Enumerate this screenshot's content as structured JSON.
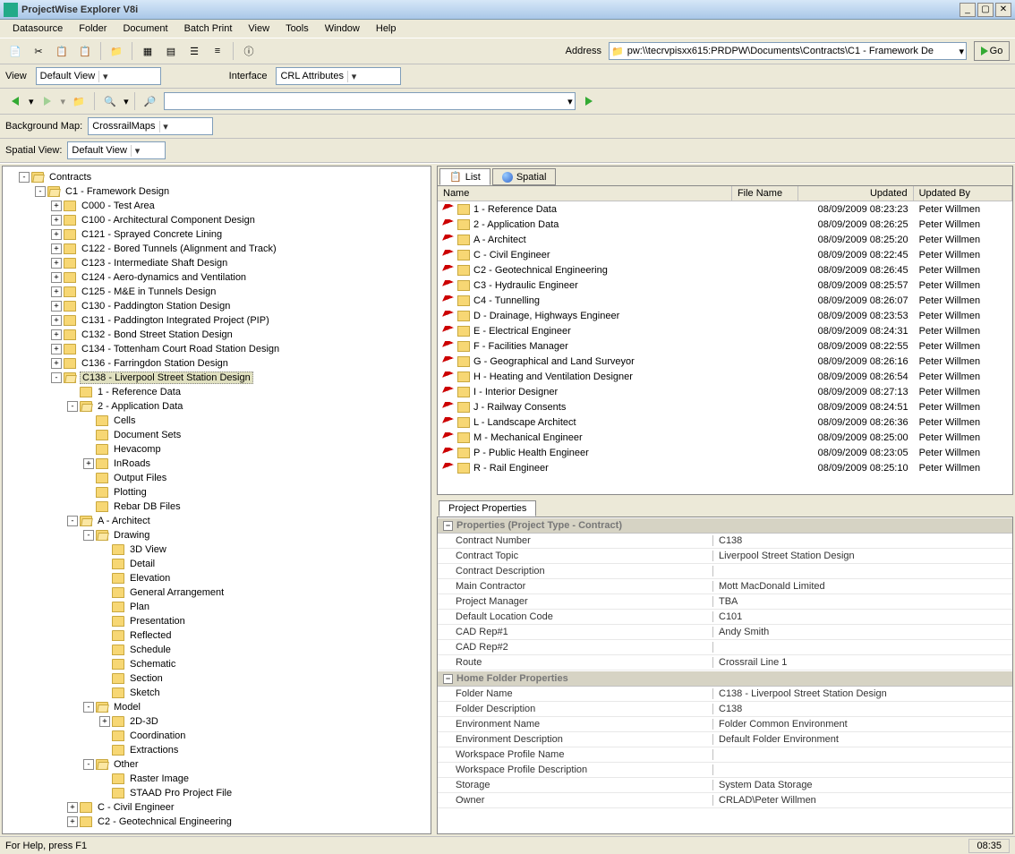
{
  "window": {
    "title": "ProjectWise Explorer V8i"
  },
  "menus": [
    "Datasource",
    "Folder",
    "Document",
    "Batch Print",
    "View",
    "Tools",
    "Window",
    "Help"
  ],
  "addressLabel": "Address",
  "address": "pw:\\\\tecrvpisxx615:PRDPW\\Documents\\Contracts\\C1 - Framework De",
  "goLabel": "Go",
  "viewLabel": "View",
  "viewValue": "Default View",
  "interfaceLabel": "Interface",
  "interfaceValue": "CRL Attributes",
  "bgMapLabel": "Background Map:",
  "bgMapValue": "CrossrailMaps",
  "spatialLabel": "Spatial View:",
  "spatialValue": "Default View",
  "tabs": {
    "list": "List",
    "spatial": "Spatial"
  },
  "listHeaders": {
    "name": "Name",
    "fileName": "File Name",
    "updated": "Updated",
    "updatedBy": "Updated By"
  },
  "listRows": [
    {
      "name": "1 - Reference Data",
      "updated": "08/09/2009 08:23:23",
      "by": "Peter Willmen"
    },
    {
      "name": "2 - Application Data",
      "updated": "08/09/2009 08:26:25",
      "by": "Peter Willmen"
    },
    {
      "name": "A - Architect",
      "updated": "08/09/2009 08:25:20",
      "by": "Peter Willmen"
    },
    {
      "name": "C - Civil Engineer",
      "updated": "08/09/2009 08:22:45",
      "by": "Peter Willmen"
    },
    {
      "name": "C2 - Geotechnical Engineering",
      "updated": "08/09/2009 08:26:45",
      "by": "Peter Willmen"
    },
    {
      "name": "C3 - Hydraulic Engineer",
      "updated": "08/09/2009 08:25:57",
      "by": "Peter Willmen"
    },
    {
      "name": "C4 - Tunnelling",
      "updated": "08/09/2009 08:26:07",
      "by": "Peter Willmen"
    },
    {
      "name": "D - Drainage, Highways Engineer",
      "updated": "08/09/2009 08:23:53",
      "by": "Peter Willmen"
    },
    {
      "name": "E - Electrical Engineer",
      "updated": "08/09/2009 08:24:31",
      "by": "Peter Willmen"
    },
    {
      "name": "F - Facilities Manager",
      "updated": "08/09/2009 08:22:55",
      "by": "Peter Willmen"
    },
    {
      "name": "G - Geographical and Land Surveyor",
      "updated": "08/09/2009 08:26:16",
      "by": "Peter Willmen"
    },
    {
      "name": "H - Heating and Ventilation Designer",
      "updated": "08/09/2009 08:26:54",
      "by": "Peter Willmen"
    },
    {
      "name": "I - Interior Designer",
      "updated": "08/09/2009 08:27:13",
      "by": "Peter Willmen"
    },
    {
      "name": "J - Railway Consents",
      "updated": "08/09/2009 08:24:51",
      "by": "Peter Willmen"
    },
    {
      "name": "L - Landscape Architect",
      "updated": "08/09/2009 08:26:36",
      "by": "Peter Willmen"
    },
    {
      "name": "M - Mechanical Engineer",
      "updated": "08/09/2009 08:25:00",
      "by": "Peter Willmen"
    },
    {
      "name": "P - Public Health Engineer",
      "updated": "08/09/2009 08:23:05",
      "by": "Peter Willmen"
    },
    {
      "name": "R - Rail Engineer",
      "updated": "08/09/2009 08:25:10",
      "by": "Peter Willmen"
    }
  ],
  "propTab": "Project Properties",
  "propCat1": "Properties (Project Type - Contract)",
  "propCat2": "Home Folder Properties",
  "props1": [
    {
      "k": "Contract Number",
      "v": "C138"
    },
    {
      "k": "Contract Topic",
      "v": "Liverpool Street Station Design"
    },
    {
      "k": "Contract Description",
      "v": ""
    },
    {
      "k": "Main Contractor",
      "v": "Mott MacDonald Limited"
    },
    {
      "k": "Project Manager",
      "v": "TBA"
    },
    {
      "k": "Default Location Code",
      "v": "C101"
    },
    {
      "k": "CAD Rep#1",
      "v": "Andy Smith"
    },
    {
      "k": "CAD Rep#2",
      "v": ""
    },
    {
      "k": "Route",
      "v": "Crossrail Line 1"
    }
  ],
  "props2": [
    {
      "k": "Folder Name",
      "v": "C138 - Liverpool Street Station Design"
    },
    {
      "k": "Folder Description",
      "v": "C138"
    },
    {
      "k": "Environment Name",
      "v": "Folder Common Environment"
    },
    {
      "k": "Environment Description",
      "v": "Default Folder Environment"
    },
    {
      "k": "Workspace Profile Name",
      "v": ""
    },
    {
      "k": "Workspace Profile Description",
      "v": ""
    },
    {
      "k": "Storage",
      "v": "System Data Storage"
    },
    {
      "k": "Owner",
      "v": "CRLAD\\Peter Willmen"
    }
  ],
  "tree": [
    {
      "d": 1,
      "e": "-",
      "l": "Contracts",
      "o": true
    },
    {
      "d": 2,
      "e": "-",
      "l": "C1 - Framework Design",
      "o": true
    },
    {
      "d": 3,
      "e": "+",
      "l": "C000 - Test Area"
    },
    {
      "d": 3,
      "e": "+",
      "l": "C100 - Architectural Component Design"
    },
    {
      "d": 3,
      "e": "+",
      "l": "C121 - Sprayed Concrete Lining"
    },
    {
      "d": 3,
      "e": "+",
      "l": "C122 - Bored Tunnels (Alignment and Track)"
    },
    {
      "d": 3,
      "e": "+",
      "l": "C123 - Intermediate Shaft Design"
    },
    {
      "d": 3,
      "e": "+",
      "l": "C124 - Aero-dynamics and Ventilation"
    },
    {
      "d": 3,
      "e": "+",
      "l": "C125 - M&E in Tunnels Design"
    },
    {
      "d": 3,
      "e": "+",
      "l": "C130 - Paddington Station Design"
    },
    {
      "d": 3,
      "e": "+",
      "l": "C131 - Paddington Integrated Project (PIP)"
    },
    {
      "d": 3,
      "e": "+",
      "l": "C132 - Bond Street Station Design"
    },
    {
      "d": 3,
      "e": "+",
      "l": "C134 - Tottenham Court Road Station Design"
    },
    {
      "d": 3,
      "e": "+",
      "l": "C136 - Farringdon Station Design"
    },
    {
      "d": 3,
      "e": "-",
      "l": "C138 - Liverpool Street Station Design",
      "sel": true,
      "o": true
    },
    {
      "d": 4,
      "e": "",
      "l": "1 - Reference Data"
    },
    {
      "d": 4,
      "e": "-",
      "l": "2 - Application Data",
      "o": true
    },
    {
      "d": 5,
      "e": "",
      "l": "Cells"
    },
    {
      "d": 5,
      "e": "",
      "l": "Document Sets"
    },
    {
      "d": 5,
      "e": "",
      "l": "Hevacomp"
    },
    {
      "d": 5,
      "e": "+",
      "l": "InRoads"
    },
    {
      "d": 5,
      "e": "",
      "l": "Output Files"
    },
    {
      "d": 5,
      "e": "",
      "l": "Plotting"
    },
    {
      "d": 5,
      "e": "",
      "l": "Rebar DB Files"
    },
    {
      "d": 4,
      "e": "-",
      "l": "A - Architect",
      "o": true
    },
    {
      "d": 5,
      "e": "-",
      "l": "Drawing",
      "o": true
    },
    {
      "d": 6,
      "e": "",
      "l": "3D View"
    },
    {
      "d": 6,
      "e": "",
      "l": "Detail"
    },
    {
      "d": 6,
      "e": "",
      "l": "Elevation"
    },
    {
      "d": 6,
      "e": "",
      "l": "General Arrangement"
    },
    {
      "d": 6,
      "e": "",
      "l": "Plan"
    },
    {
      "d": 6,
      "e": "",
      "l": "Presentation"
    },
    {
      "d": 6,
      "e": "",
      "l": "Reflected"
    },
    {
      "d": 6,
      "e": "",
      "l": "Schedule"
    },
    {
      "d": 6,
      "e": "",
      "l": "Schematic"
    },
    {
      "d": 6,
      "e": "",
      "l": "Section"
    },
    {
      "d": 6,
      "e": "",
      "l": "Sketch"
    },
    {
      "d": 5,
      "e": "-",
      "l": "Model",
      "o": true
    },
    {
      "d": 6,
      "e": "+",
      "l": "2D-3D"
    },
    {
      "d": 6,
      "e": "",
      "l": "Coordination"
    },
    {
      "d": 6,
      "e": "",
      "l": "Extractions"
    },
    {
      "d": 5,
      "e": "-",
      "l": "Other",
      "o": true
    },
    {
      "d": 6,
      "e": "",
      "l": "Raster Image"
    },
    {
      "d": 6,
      "e": "",
      "l": "STAAD Pro Project File"
    },
    {
      "d": 4,
      "e": "+",
      "l": "C - Civil Engineer"
    },
    {
      "d": 4,
      "e": "+",
      "l": "C2 - Geotechnical Engineering"
    }
  ],
  "status": {
    "help": "For Help, press F1",
    "time": "08:35"
  }
}
